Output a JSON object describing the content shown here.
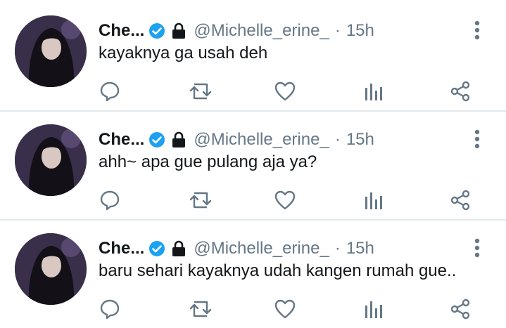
{
  "tweets": [
    {
      "name": "Che...",
      "handle": "@Michelle_erine_",
      "separator": "·",
      "time": "15h",
      "text": "kayaknya ga usah deh"
    },
    {
      "name": "Che...",
      "handle": "@Michelle_erine_",
      "separator": "·",
      "time": "15h",
      "text": "ahh~ apa gue pulang aja ya?"
    },
    {
      "name": "Che...",
      "handle": "@Michelle_erine_",
      "separator": "·",
      "time": "15h",
      "text": "baru sehari kayaknya udah kangen rumah gue.."
    }
  ],
  "icons": {
    "verified": "verified-badge-icon",
    "protected": "lock-icon",
    "more": "more-vertical-icon",
    "reply": "reply-icon",
    "retweet": "retweet-icon",
    "like": "heart-icon",
    "analytics": "analytics-icon",
    "share": "share-icon"
  },
  "colors": {
    "verified": "#1da1f2",
    "icon": "#657786",
    "text": "#14171a",
    "divider": "#e1e8ed"
  }
}
